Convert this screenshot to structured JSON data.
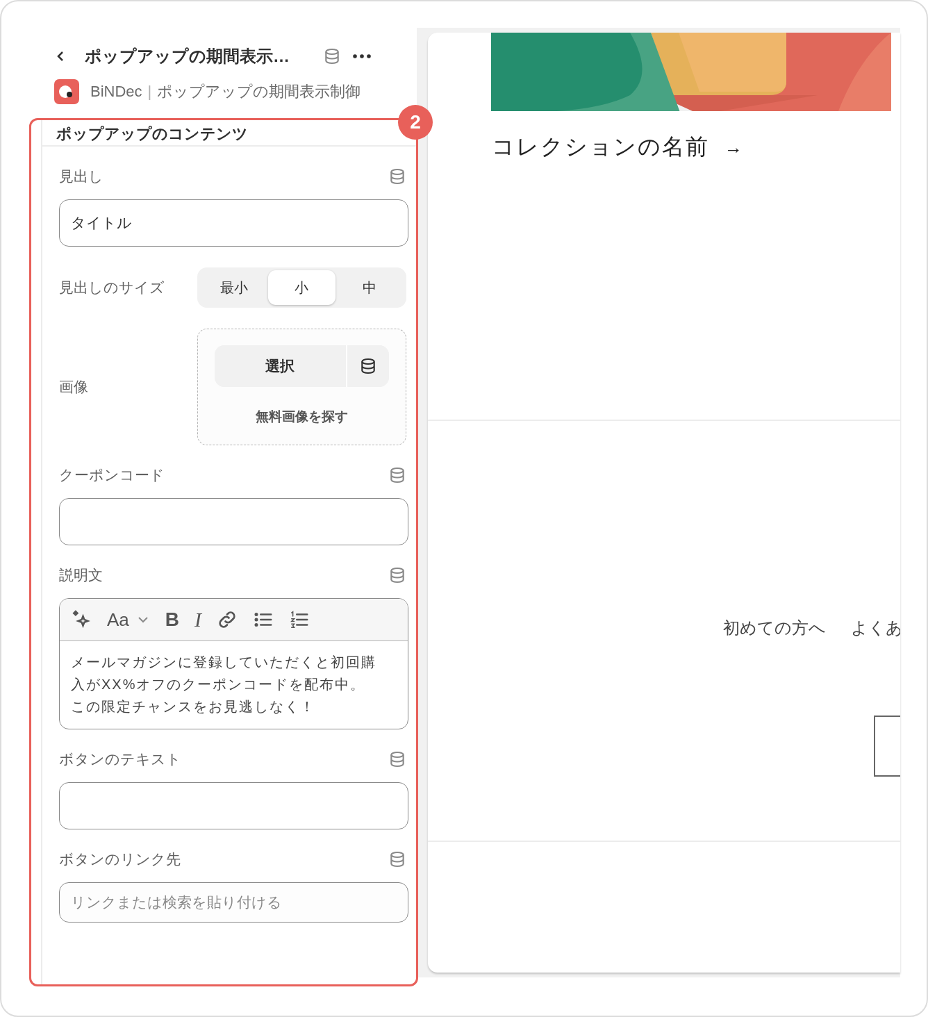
{
  "header": {
    "title": "ポップアップの期間表示…",
    "app_name": "BiNDec",
    "separator": "|",
    "app_subtitle": "ポップアップの期間表示制御"
  },
  "callout": {
    "number": "2"
  },
  "section": {
    "title": "ポップアップのコンテンツ",
    "fields": [
      {
        "kind": "text",
        "label": "見出し",
        "value": "タイトル"
      },
      {
        "kind": "segmented",
        "label": "見出しのサイズ",
        "options": [
          {
            "label": "最小",
            "selected": false
          },
          {
            "label": "小",
            "selected": true
          },
          {
            "label": "中",
            "selected": false
          }
        ]
      },
      {
        "label": "画像",
        "button": "選択",
        "link": "無料画像を探す"
      },
      {
        "kind": "text",
        "label": "クーポンコード"
      },
      {
        "kind": "richtext",
        "label": "説明文",
        "toolbar": [
          {
            "kind": "sparkle"
          },
          {
            "kind": "font",
            "label": "Aa"
          },
          {
            "kind": "bold",
            "label": "B"
          },
          {
            "kind": "italic",
            "label": "I"
          },
          {
            "kind": "link"
          },
          {
            "kind": "bullets"
          },
          {
            "kind": "numbers"
          }
        ],
        "paragraphs": [
          "メールマガジンに登録していただくと初回購入がXX%オフのクーポンコードを配布中。",
          "この限定チャンスをお見逃しなく！"
        ]
      },
      {
        "kind": "text",
        "label": "ボタンのテキスト"
      },
      {
        "kind": "text",
        "label": "ボタンのリンク先",
        "placeholder": "リンクまたは検索を貼り付ける"
      }
    ]
  },
  "preview": {
    "collection_title": "コレクションの名前",
    "arrow": "→",
    "nav_links": [
      "初めての方へ",
      "よくあ"
    ]
  }
}
